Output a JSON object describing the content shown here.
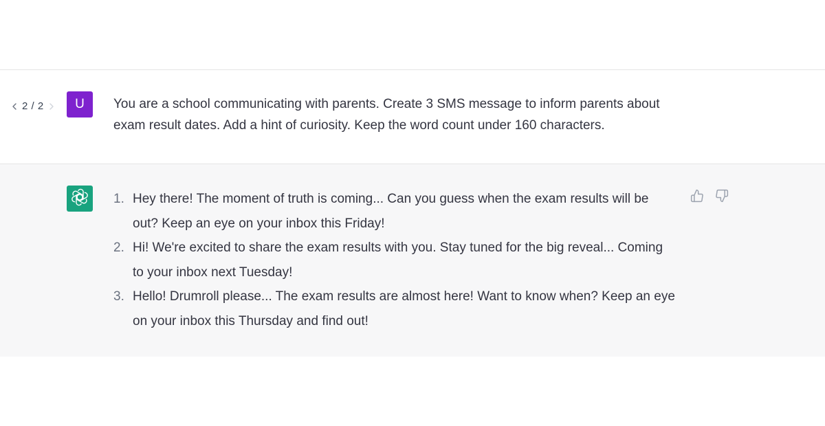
{
  "colors": {
    "user_avatar_bg": "#7e22ce",
    "bot_avatar_bg": "#19a37f",
    "assistant_bg": "#f7f7f8",
    "icon_gray": "#9ca3af"
  },
  "user_message": {
    "pager": "2 / 2",
    "avatar_letter": "U",
    "text": "You are a school communicating with parents. Create 3 SMS message to inform parents about exam result dates. Add a hint of curiosity. Keep the word count under 160 characters."
  },
  "assistant_message": {
    "avatar_icon": "openai-logo-icon",
    "items": [
      {
        "number": "1.",
        "text": "Hey there! The moment of truth is coming... Can you guess when the exam results will be out? Keep an eye on your inbox this Friday!"
      },
      {
        "number": "2.",
        "text": "Hi! We're excited to share the exam results with you. Stay tuned for the big reveal... Coming to your inbox next Tuesday!"
      },
      {
        "number": "3.",
        "text": "Hello! Drumroll please... The exam results are almost here! Want to know when? Keep an eye on your inbox this Thursday and find out!"
      }
    ],
    "feedback_icons": [
      "thumbs-up-icon",
      "thumbs-down-icon"
    ]
  }
}
